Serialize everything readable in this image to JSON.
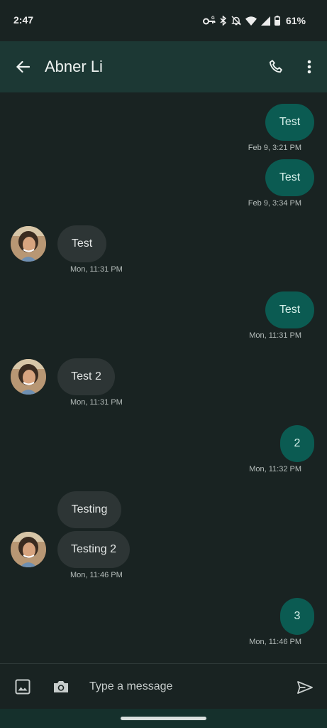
{
  "status_bar": {
    "time": "2:47",
    "battery": "61%",
    "icons": [
      "vpn-key-icon",
      "bluetooth-icon",
      "notifications-off-icon",
      "wifi-icon",
      "signal-icon",
      "battery-icon"
    ]
  },
  "app_bar": {
    "contact_name": "Abner Li",
    "back_icon": "arrow-back-icon",
    "call_icon": "phone-icon",
    "more_icon": "more-vert-icon"
  },
  "messages": [
    {
      "direction": "outgoing",
      "text": "Test",
      "time": "Feb 9, 3:21 PM"
    },
    {
      "direction": "outgoing",
      "text": "Test",
      "time": "Feb 9, 3:34 PM"
    },
    {
      "direction": "incoming",
      "text": "Test",
      "time": "Mon, 11:31 PM"
    },
    {
      "direction": "outgoing",
      "text": "Test",
      "time": "Mon, 11:31 PM"
    },
    {
      "direction": "incoming",
      "text": "Test 2",
      "time": "Mon, 11:31 PM"
    },
    {
      "direction": "outgoing",
      "text": "2",
      "time": "Mon, 11:32 PM"
    },
    {
      "direction": "incoming",
      "text": "Testing",
      "time": ""
    },
    {
      "direction": "incoming",
      "text": "Testing 2",
      "time": "Mon, 11:46 PM"
    },
    {
      "direction": "outgoing",
      "text": "3",
      "time": "Mon, 11:46 PM"
    }
  ],
  "composer": {
    "placeholder": "Type a message",
    "value": ""
  },
  "colors": {
    "background": "#192322",
    "app_bar": "#1c3834",
    "outgoing_bubble": "#0b5b52",
    "incoming_bubble": "#2d3535"
  }
}
